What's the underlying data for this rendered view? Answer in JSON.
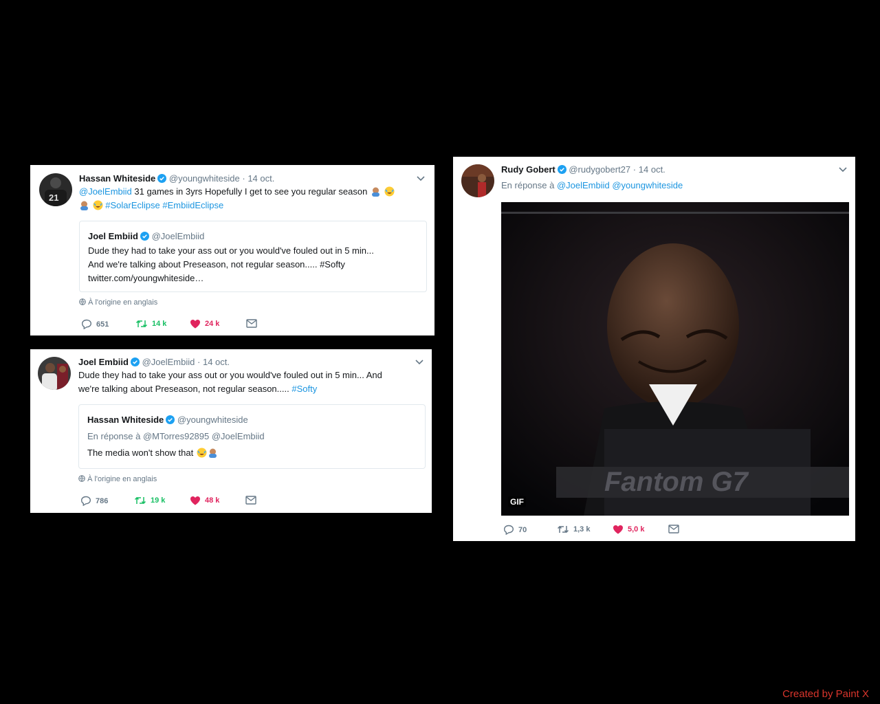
{
  "tweet1": {
    "name": "Hassan Whiteside",
    "handle": "@youngwhiteside",
    "dot": "·",
    "date": "14 oct.",
    "mention": "@JoelEmbiid",
    "text_a": "31 games in 3yrs Hopefully I get to see you regular season",
    "hashtag1": "#SolarEclipse",
    "hashtag2": "#EmbiidEclipse",
    "quote": {
      "name": "Joel Embiid",
      "handle": "@JoelEmbiid",
      "line1": "Dude they had to take your ass out or you would've fouled out in 5 min...",
      "line2": "And we're talking about Preseason, not regular season..... #Softy",
      "line3": "twitter.com/youngwhiteside…"
    },
    "origin": "À l'origine en anglais",
    "replies": "651",
    "retweets": "14 k",
    "likes": "24 k"
  },
  "tweet2": {
    "name": "Joel Embiid",
    "handle": "@JoelEmbiid",
    "dot": "·",
    "date": "14 oct.",
    "line1": "Dude they had to take your ass out or you would've fouled out in 5 min... And",
    "line2": "we're talking about Preseason, not regular season.....",
    "hashtag": "#Softy",
    "quote": {
      "name": "Hassan Whiteside",
      "handle": "@youngwhiteside",
      "reply_to": "En réponse à @MTorres92895 @JoelEmbiid",
      "text": "The media won't show that"
    },
    "origin": "À l'origine en anglais",
    "replies": "786",
    "retweets": "19 k",
    "likes": "48 k"
  },
  "tweet3": {
    "name": "Rudy Gobert",
    "handle": "@rudygobert27",
    "dot": "·",
    "date": "14 oct.",
    "reply_prefix": "En réponse à",
    "reply_mentions": "@JoelEmbiid @youngwhiteside",
    "gif_label": "GIF",
    "keyboard_text": "Fantom G7",
    "replies": "70",
    "retweets": "1,3 k",
    "likes": "5,0 k"
  },
  "credit": "Created by Paint X",
  "colors": {
    "link": "#1b95e0",
    "retweet": "#17bf63",
    "like": "#e0245e",
    "muted": "#657786"
  }
}
